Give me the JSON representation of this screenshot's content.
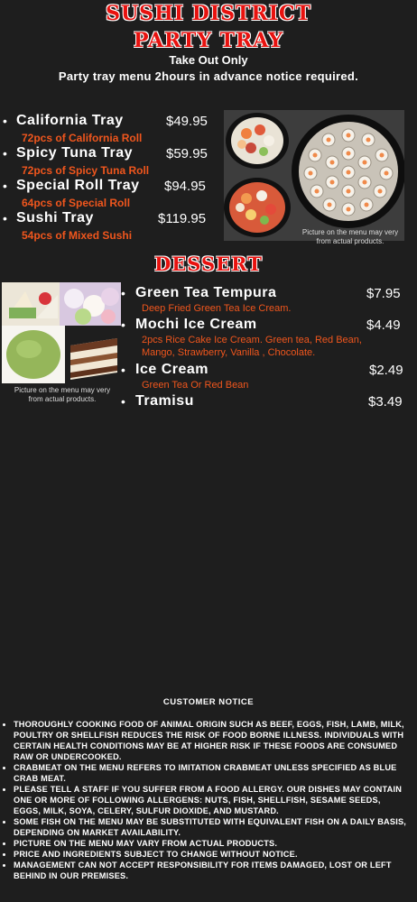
{
  "header": {
    "restaurant": "SUSHI DISTRICT",
    "menu_title": "PARTY TRAY",
    "subtitle": "Take Out Only",
    "advance_notice": "Party tray menu 2hours in advance notice required."
  },
  "party_trays": [
    {
      "name": "California Tray",
      "price": "$49.95",
      "detail": "72pcs of California Roll"
    },
    {
      "name": "Spicy Tuna Tray",
      "price": "$59.95",
      "detail": "72pcs of Spicy Tuna Roll"
    },
    {
      "name": "Special Roll Tray",
      "price": "$94.95",
      "detail": "64pcs of Special Roll"
    },
    {
      "name": "Sushi Tray",
      "price": "$119.95",
      "detail": "54pcs of Mixed Sushi"
    }
  ],
  "tray_photo_caption": "Picture on the menu may very from actual products.",
  "dessert": {
    "title": "DESSERT",
    "items": [
      {
        "name": "Green Tea Tempura",
        "price": "$7.95",
        "detail": "Deep Fried Green Tea Ice Cream."
      },
      {
        "name": "Mochi Ice Cream",
        "price": "$4.49",
        "detail": "2pcs Rice Cake Ice Cream. Green tea, Red Bean, Mango, Strawberry, Vanilla , Chocolate."
      },
      {
        "name": "Ice Cream",
        "price": "$2.49",
        "detail": "Green Tea Or Red Bean"
      },
      {
        "name": "Tramisu",
        "price": "$3.49",
        "detail": ""
      }
    ],
    "photo_caption": "Picture on the menu may very from actual products."
  },
  "notice": {
    "title": "CUSTOMER NOTICE",
    "items": [
      "THOROUGHLY COOKING FOOD OF ANIMAL ORIGIN SUCH AS BEEF, EGGS, FISH, LAMB, MILK, POULTRY OR SHELLFISH REDUCES THE RISK OF FOOD BORNE ILLNESS. INDIVIDUALS WITH CERTAIN HEALTH CONDITIONS MAY BE AT HIGHER RISK IF THESE FOODS ARE CONSUMED RAW OR UNDERCOOKED.",
      "CRABMEAT ON THE MENU REFERS TO IMITATION CRABMEAT UNLESS SPECIFIED AS BLUE CRAB MEAT.",
      "PLEASE TELL A STAFF IF YOU SUFFER FROM A FOOD ALLERGY. OUR DISHES MAY CONTAIN ONE OR MORE OF FOLLOWING ALLERGENS: NUTS, FISH, SHELLFISH, SESAME SEEDS, EGGS, MILK, SOYA, CELERY, SULFUR DIOXIDE, AND MUSTARD.",
      "SOME FISH ON THE MENU MAY BE SUBSTITUTED WITH EQUIVALENT FISH ON A DAILY BASIS, DEPENDING ON MARKET AVAILABILITY.",
      "PICTURE ON THE MENU MAY VARY FROM ACTUAL PRODUCTS.",
      "PRICE AND INGREDIENTS SUBJECT TO CHANGE WITHOUT NOTICE.",
      "MANAGEMENT CAN NOT ACCEPT RESPONSIBILITY FOR ITEMS DAMAGED, LOST OR LEFT BEHIND IN OUR PREMISES."
    ]
  },
  "colors": {
    "background": "#1e1e1e",
    "title_red": "#e8120f",
    "accent_orange": "#f0561d"
  }
}
